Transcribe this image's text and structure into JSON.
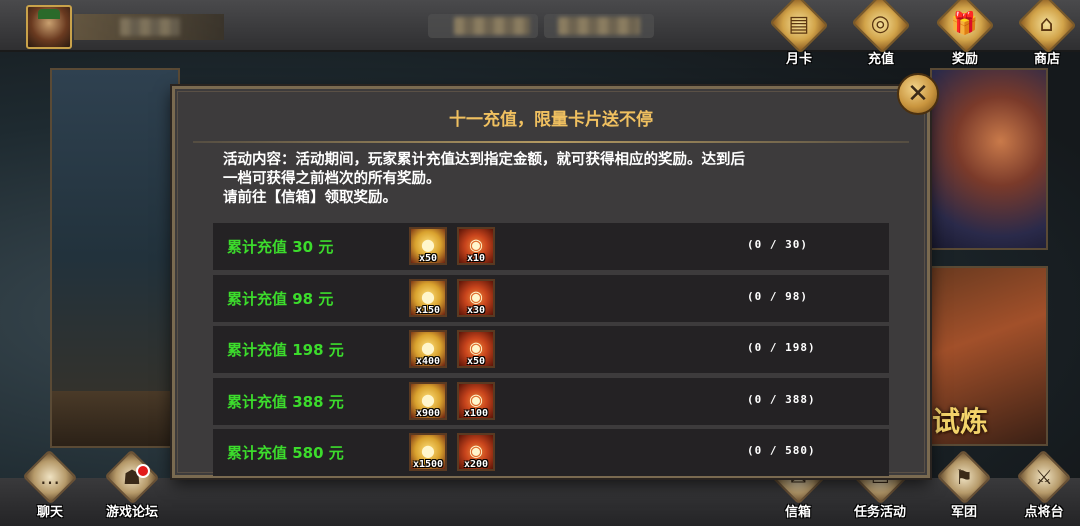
{
  "top_bar": {
    "buttons": [
      {
        "label": "月卡",
        "icon": "month-card-icon",
        "glyph": "▤"
      },
      {
        "label": "充值",
        "icon": "recharge-coins-icon",
        "glyph": "◎"
      },
      {
        "label": "奖励",
        "icon": "gift-box-icon",
        "glyph": "🎁"
      },
      {
        "label": "商店",
        "icon": "shop-pagoda-icon",
        "glyph": "⌂"
      }
    ]
  },
  "bottom_bar": {
    "buttons": [
      {
        "label": "聊天",
        "icon": "chat-bubble-icon",
        "glyph": "…"
      },
      {
        "label": "游戏论坛",
        "icon": "forum-users-icon",
        "glyph": "☗",
        "notification": true
      },
      {
        "label": "信箱",
        "icon": "mailbox-icon",
        "glyph": "✉"
      },
      {
        "label": "任务活动",
        "icon": "task-scroll-icon",
        "glyph": "▭"
      },
      {
        "label": "军团",
        "icon": "legion-horn-icon",
        "glyph": "⚑"
      },
      {
        "label": "点将台",
        "icon": "general-stage-sword-icon",
        "glyph": "⚔"
      }
    ]
  },
  "background": {
    "side_banner_text": "试炼"
  },
  "modal": {
    "title": "十一充值，限量卡片送不停",
    "close_icon": "close-x-icon",
    "description_line1": "活动内容：活动期间，玩家累计充值达到指定金额，就可获得相应的奖励。达到后",
    "description_line2": "一档可获得之前档次的所有奖励。",
    "description_line3": "请前往【信箱】领取奖励。",
    "rewards": [
      {
        "label": "累计充值 30 元",
        "coin_qty": "x50",
        "card_qty": "x10",
        "progress": "(0 / 30)"
      },
      {
        "label": "累计充值 98 元",
        "coin_qty": "x150",
        "card_qty": "x30",
        "progress": "(0 / 98)"
      },
      {
        "label": "累计充值 198 元",
        "coin_qty": "x400",
        "card_qty": "x50",
        "progress": "(0 / 198)"
      },
      {
        "label": "累计充值 388 元",
        "coin_qty": "x900",
        "card_qty": "x100",
        "progress": "(0 / 388)"
      },
      {
        "label": "累计充值 580 元",
        "coin_qty": "x1500",
        "card_qty": "x200",
        "progress": "(0 / 580)"
      }
    ]
  },
  "colors": {
    "title": "#f0c060",
    "tier_label": "#3cdc2c",
    "panel": "#3d3b3c",
    "row": "#242224"
  }
}
